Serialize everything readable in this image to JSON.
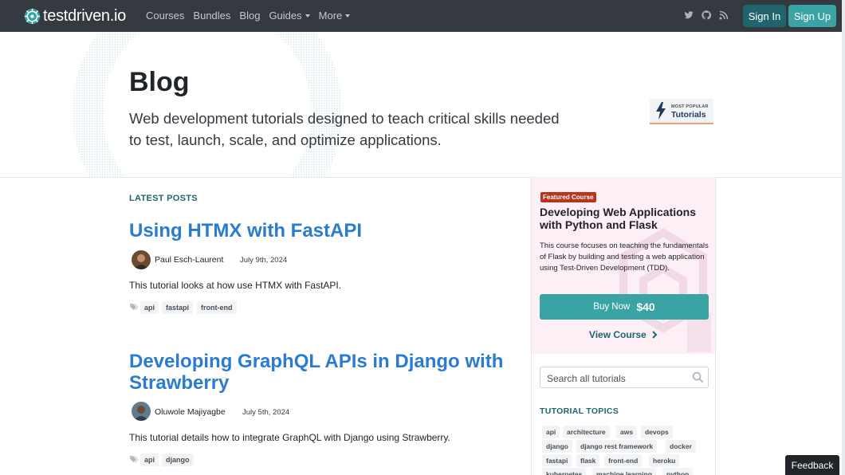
{
  "nav": {
    "brand": "testdriven.io",
    "links": [
      "Courses",
      "Bundles",
      "Blog",
      "Guides",
      "More"
    ],
    "sign_in": "Sign In",
    "sign_up": "Sign Up"
  },
  "hero": {
    "title": "Blog",
    "subtitle": "Web development tutorials designed to teach critical skills needed to test, launch, scale, and optimize applications.",
    "badge_small": "MOST POPULAR",
    "badge_big": "Tutorials"
  },
  "main": {
    "section_label": "LATEST POSTS",
    "posts": [
      {
        "title": "Using HTMX with FastAPI",
        "author": "Paul Esch-Laurent",
        "date": "July 9th, 2024",
        "description": "This tutorial looks at how use HTMX with FastAPI.",
        "tags": [
          "api",
          "fastapi",
          "front-end"
        ]
      },
      {
        "title": "Developing GraphQL APIs in Django with Strawberry",
        "author": "Oluwole Majiyagbe",
        "date": "July 5th, 2024",
        "description": "This tutorial details how to integrate GraphQL with Django using Strawberry.",
        "tags": [
          "api",
          "django"
        ]
      }
    ]
  },
  "sidebar": {
    "featured_badge": "Featured Course",
    "featured_title": "Developing Web Applications with Python and Flask",
    "featured_desc": "This course focuses on teaching the fundamentals of Flask by building and testing a web application using Test-Driven Development (TDD).",
    "buy_label": "Buy Now",
    "buy_price": "$40",
    "view_course": "View Course",
    "search_placeholder": "Search all tutorials",
    "topics_label": "TUTORIAL TOPICS",
    "topics": [
      "api",
      "architecture",
      "aws",
      "devops",
      "django",
      "django rest framework",
      "docker",
      "fastapi",
      "flask",
      "front-end",
      "heroku",
      "kubernetes",
      "machine learning",
      "python"
    ]
  },
  "feedback": "Feedback",
  "colors": {
    "navbar": "#343a40",
    "accent_teal": "#3aa3a3",
    "link_blue": "#2a7bd2",
    "featured_red": "#b8341c"
  }
}
